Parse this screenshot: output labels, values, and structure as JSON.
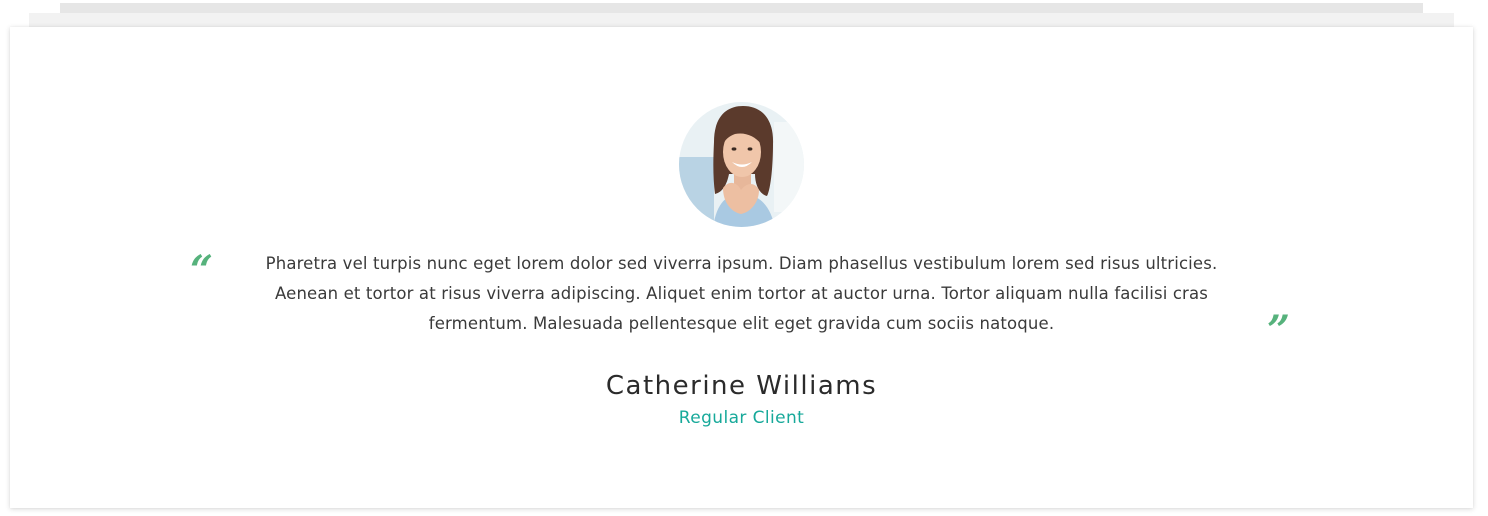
{
  "testimonial": {
    "quote_open": "“",
    "quote_close": "”",
    "text": "Pharetra vel turpis nunc eget lorem dolor sed viverra ipsum. Diam phasellus vestibulum lorem sed risus ultricies. Aenean et tortor at risus viverra adipiscing. Aliquet enim tortor at auctor urna. Tortor aliquam nulla facilisi cras fermentum. Malesuada pellentesque elit eget gravida cum sociis natoque.",
    "client_name": "Catherine Williams",
    "client_role": "Regular Client"
  },
  "colors": {
    "quote_mark": "#56b27c",
    "role_accent": "#17a99a",
    "name_text": "#2b2b2b",
    "body_text": "#3a3a3a"
  }
}
